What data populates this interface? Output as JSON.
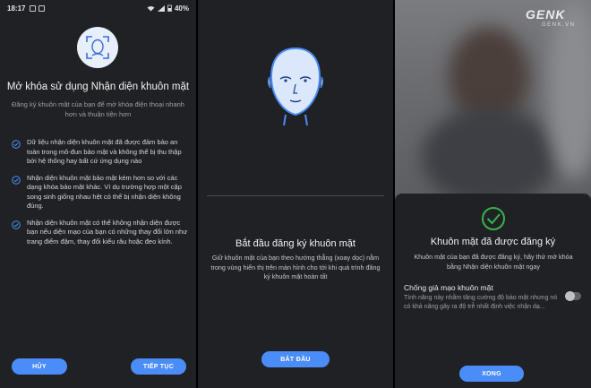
{
  "status_bar": {
    "time": "18:17",
    "battery": "40%"
  },
  "setup_intro": {
    "title": "Mở khóa sử dụng Nhận diện khuôn mặt",
    "description": "Đăng ký khuôn mặt của bạn để mở khóa điện thoại nhanh hơn và thuận tiện hơn",
    "bullets": [
      "Dữ liệu nhận diện khuôn mặt đã được đảm bảo an toàn trong mô-đun bảo mật và không thể bị thu thập bởi hệ thống hay bất cứ ứng dụng nào",
      "Nhận diện khuôn mặt bảo mật kém hơn so với các dạng khóa bảo mật khác. Ví dụ trường hợp một cặp song sinh giống nhau hệt có thể bị nhận diện không đúng.",
      "Nhận diện khuôn mặt có thể không nhận diện được bạn nếu diện mạo của bạn có những thay đổi lớn như trang điểm đậm, thay đổi kiểu râu hoặc đeo kính."
    ],
    "cancel_label": "HỦY",
    "next_label": "TIẾP TỤC"
  },
  "enroll": {
    "title": "Bắt đầu đăng ký khuôn mặt",
    "description": "Giữ khuôn mặt của bạn theo hướng thẳng (xoay dọc) nằm trong vùng hiển thị trên màn hình cho tới khi quá trình đăng ký khuôn mặt hoàn tất",
    "start_label": "BẮT ĐẦU"
  },
  "done": {
    "title": "Khuôn mặt đã được đăng ký",
    "description": "Khuôn mặt của bạn đã được đăng ký, hãy thử mở khóa bằng Nhận diện khuôn mặt ngay",
    "anti_spoof_title": "Chống giả mạo khuôn mặt",
    "anti_spoof_description": "Tính năng này nhằm tăng cường độ bảo mật nhưng nó có khả năng gây ra độ trễ nhất định việc nhận dạ...",
    "anti_spoof_enabled": false,
    "done_label": "XONG"
  },
  "watermark": {
    "brand": "GENK",
    "sub": "GENK.VN"
  },
  "colors": {
    "accent": "#4a8df8",
    "success": "#37b24d",
    "panel_bg": "#202124"
  }
}
